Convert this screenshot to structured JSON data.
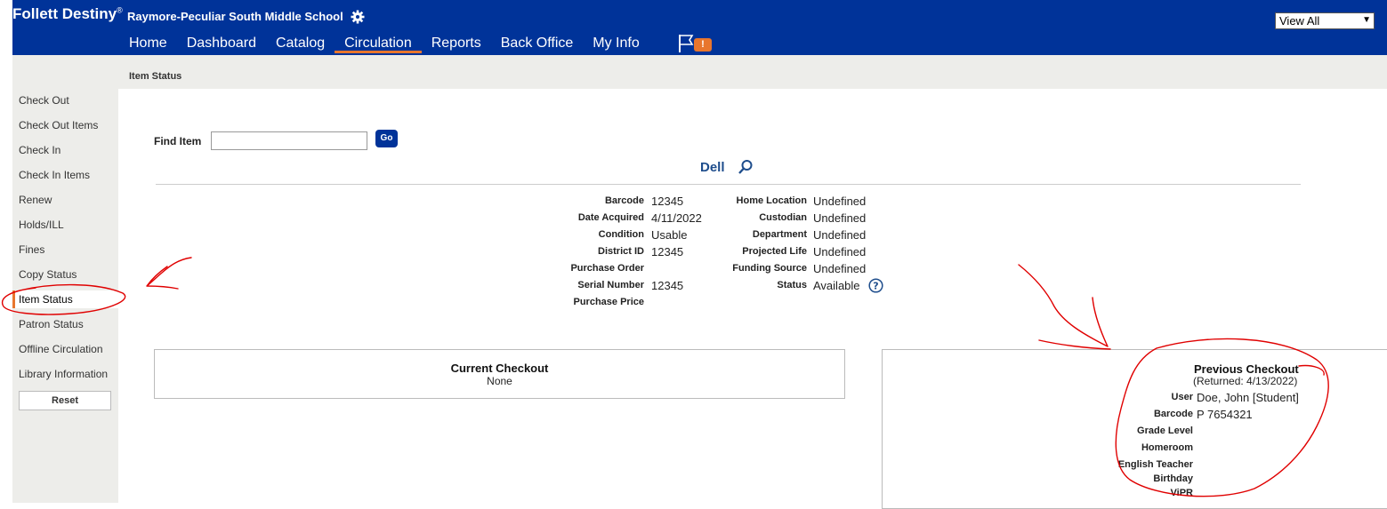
{
  "header": {
    "brand": "Follett Destiny",
    "school": "Raymore-Peculiar South Middle School",
    "nav": [
      "Home",
      "Dashboard",
      "Catalog",
      "Circulation",
      "Reports",
      "Back Office",
      "My Info"
    ],
    "notification_badge": "!",
    "view_select": "View All"
  },
  "sidebar": {
    "items": [
      "Check Out",
      "Check Out Items",
      "Check In",
      "Check In Items",
      "Renew",
      "Holds/ILL",
      "Fines",
      "Copy Status",
      "Item Status",
      "Patron Status",
      "Offline Circulation",
      "Library Information"
    ],
    "reset": "Reset"
  },
  "breadcrumb": "Item Status",
  "find": {
    "label": "Find Item",
    "value": "",
    "go": "Go"
  },
  "item": {
    "title": "Dell",
    "left_fields": [
      {
        "label": "Barcode",
        "value": "12345"
      },
      {
        "label": "Date Acquired",
        "value": "4/11/2022"
      },
      {
        "label": "Condition",
        "value": "Usable"
      },
      {
        "label": "District ID",
        "value": "12345"
      },
      {
        "label": "Purchase Order",
        "value": ""
      },
      {
        "label": "Serial Number",
        "value": "12345"
      },
      {
        "label": "Purchase Price",
        "value": ""
      }
    ],
    "right_fields": [
      {
        "label": "Home Location",
        "value": "Undefined"
      },
      {
        "label": "Custodian",
        "value": "Undefined"
      },
      {
        "label": "Department",
        "value": "Undefined"
      },
      {
        "label": "Projected Life",
        "value": "Undefined"
      },
      {
        "label": "Funding Source",
        "value": "Undefined"
      },
      {
        "label": "Status",
        "value": "Available"
      }
    ]
  },
  "current_checkout": {
    "title": "Current Checkout",
    "value": "None"
  },
  "previous_checkout": {
    "title": "Previous Checkout",
    "returned": "(Returned: 4/13/2022)",
    "fields": [
      {
        "label": "User",
        "value": "Doe, John [Student]"
      },
      {
        "label": "Barcode",
        "value": "P 7654321"
      },
      {
        "label": "Grade Level",
        "value": ""
      },
      {
        "label": "Homeroom",
        "value": ""
      },
      {
        "label": "English Teacher",
        "value": ""
      },
      {
        "label": "Birthday",
        "value": ""
      },
      {
        "label": "ViPR",
        "value": ""
      }
    ]
  },
  "colors": {
    "header": "#003399",
    "accent": "#e8762d",
    "sidebar": "#ededea",
    "annotation": "#e00000"
  },
  "icons": [
    "gear-icon",
    "flag-icon",
    "magnifier-icon",
    "help-icon",
    "chevron-down-icon"
  ]
}
